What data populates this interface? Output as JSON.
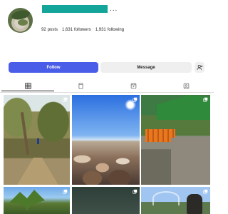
{
  "profile": {
    "more_label": "...",
    "stats": {
      "posts_value": "92",
      "posts_label": "posts",
      "followers_value": "1,631",
      "followers_label": "followers",
      "following_value": "1,931",
      "following_label": "following"
    }
  },
  "actions": {
    "follow_label": "Follow",
    "message_label": "Message",
    "add_person_icon": "add-person-icon"
  },
  "tabs": [
    {
      "icon": "grid-icon",
      "active": true
    },
    {
      "icon": "reels-icon",
      "active": false
    },
    {
      "icon": "guides-icon",
      "active": false
    },
    {
      "icon": "tagged-icon",
      "active": false
    }
  ],
  "posts": [
    {
      "subject": "forest path",
      "badge": "multi-photo"
    },
    {
      "subject": "pebble beach under blue sky",
      "badge": "multi-photo"
    },
    {
      "subject": "carrot harvester",
      "badge": "multi-photo"
    },
    {
      "subject": "palm trees",
      "badge": "multi-photo"
    },
    {
      "subject": "dark scene",
      "badge": "multi-photo"
    },
    {
      "subject": "person outdoors",
      "badge": "multi-photo"
    }
  ],
  "colors": {
    "accent": "#4a5de8",
    "username_bar": "#13a59a",
    "button_gray": "#efefef",
    "divider": "#dbdbdb"
  }
}
